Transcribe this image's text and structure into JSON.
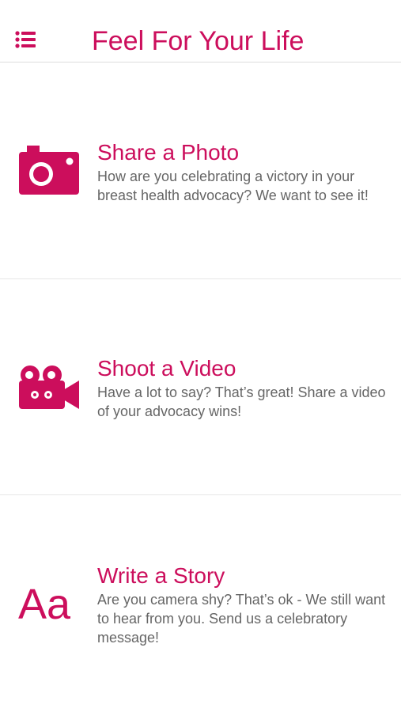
{
  "header": {
    "title": "Feel For Your Life",
    "menu_icon": "list-menu-icon"
  },
  "accent_color": "#cc0e5c",
  "items": [
    {
      "icon": "camera-icon",
      "title": "Share a Photo",
      "description": "How are you celebrating a victory in your breast health advocacy? We want to see it!"
    },
    {
      "icon": "video-camera-icon",
      "title": "Shoot a Video",
      "description": "Have a lot to say? That’s great! Share a video of your advocacy wins!"
    },
    {
      "icon": "text-aa-icon",
      "icon_text": "Aa",
      "title": "Write a Story",
      "description": "Are you camera shy? That’s ok - We still want to hear from you. Send us a celebratory message!"
    }
  ]
}
